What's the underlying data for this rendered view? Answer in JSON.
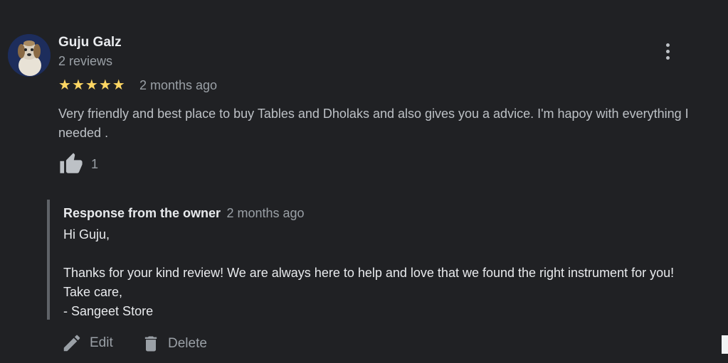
{
  "review": {
    "author": "Guju Galz",
    "review_count": "2 reviews",
    "rating": 5,
    "date": "2 months ago",
    "text": "Very friendly and best place to buy Tables and Dholaks and also gives you a advice. I'm hapoy with everything I needed .",
    "likes": "1"
  },
  "owner_response": {
    "label": "Response from the owner",
    "date": "2 months ago",
    "greeting": "Hi Guju,",
    "body": "Thanks for your kind review! We are always here to help and love that we found the right instrument for you! Take care,",
    "signature": "- Sangeet Store"
  },
  "actions": {
    "edit_label": "Edit",
    "delete_label": "Delete"
  },
  "icons": [
    "more-vert-icon",
    "star-icon",
    "thumb-up-icon",
    "edit-icon",
    "delete-icon"
  ],
  "colors": {
    "background": "#202124",
    "star": "#fdd663",
    "text": "#bdc1c6",
    "title": "#e8eaed"
  }
}
